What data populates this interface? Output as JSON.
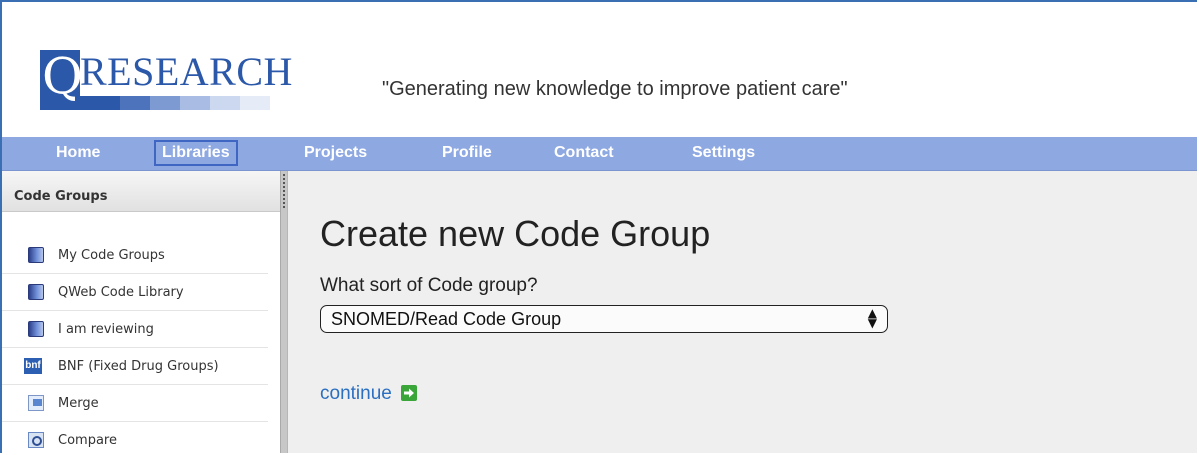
{
  "header": {
    "logo_letter": "Q",
    "logo_text": "RESEARCH",
    "tagline": "\"Generating new knowledge to improve patient care\""
  },
  "nav": {
    "items": [
      {
        "label": "Home"
      },
      {
        "label": "Libraries",
        "active": true
      },
      {
        "label": "Projects"
      },
      {
        "label": "Profile"
      },
      {
        "label": "Contact"
      },
      {
        "label": "Settings"
      }
    ]
  },
  "sidebar": {
    "title": "Code Groups",
    "items": [
      {
        "label": "My Code Groups",
        "icon": "book-icon"
      },
      {
        "label": "QWeb Code Library",
        "icon": "book-icon"
      },
      {
        "label": "I am reviewing",
        "icon": "book-icon"
      },
      {
        "label": "BNF (Fixed Drug Groups)",
        "icon": "bnf-icon",
        "icon_text": "bnf"
      },
      {
        "label": "Merge",
        "icon": "merge-icon"
      },
      {
        "label": "Compare",
        "icon": "compare-icon"
      }
    ]
  },
  "main": {
    "title": "Create new Code Group",
    "question": "What sort of Code group?",
    "select_value": "SNOMED/Read Code Group",
    "continue_label": "continue"
  },
  "colors": {
    "brand_blue": "#2b58a8",
    "nav_bg": "#8ea8e2",
    "link": "#2b6fc0",
    "continue_icon": "#3aa63a"
  }
}
